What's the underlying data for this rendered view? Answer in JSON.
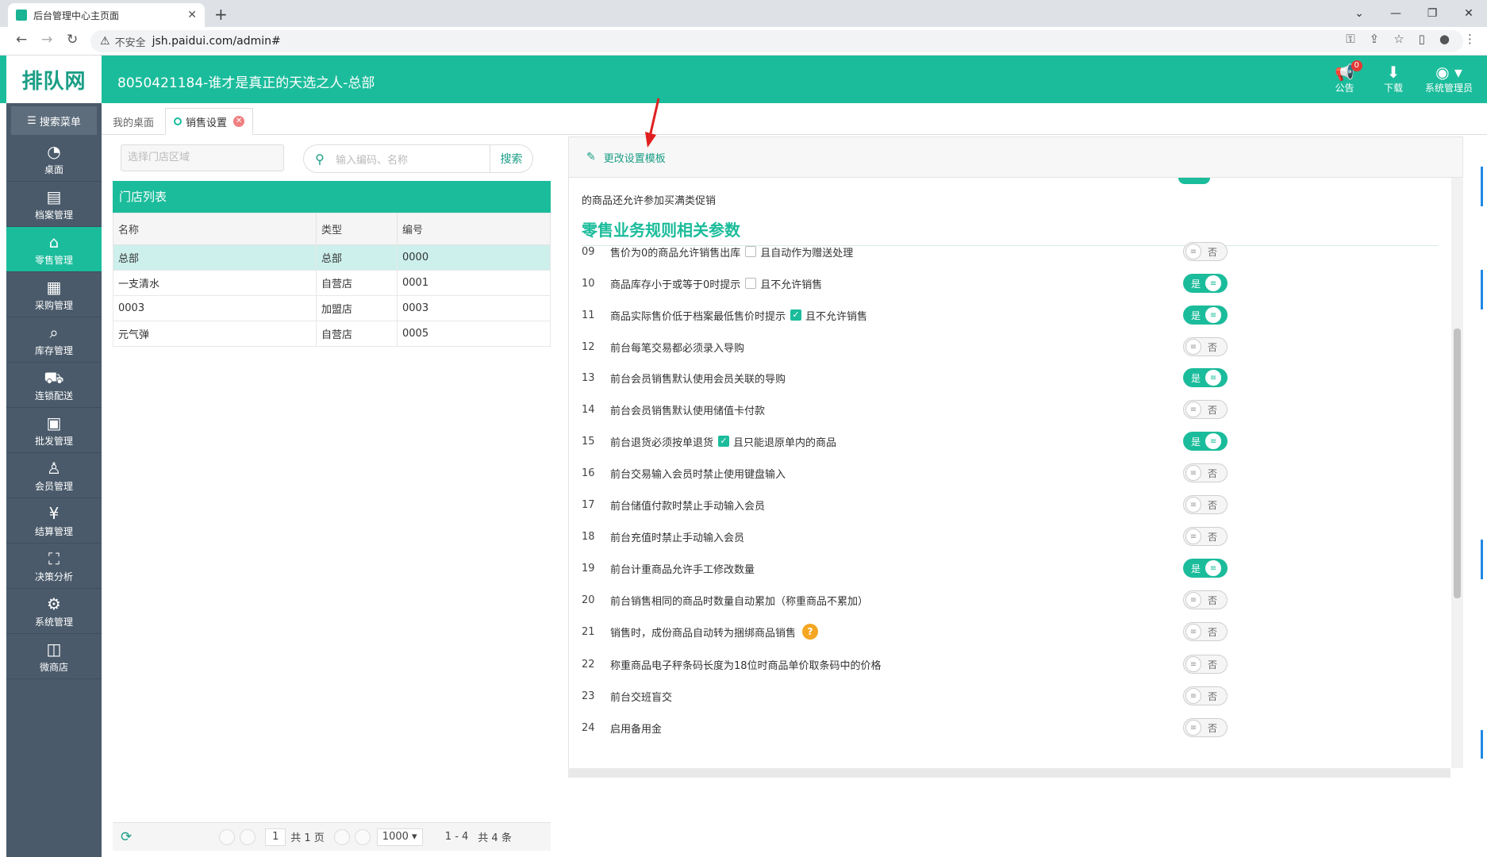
{
  "browser": {
    "tab_title": "后台管理中心主页面",
    "insecure_label": "不安全",
    "url": "jsh.paidui.com/admin#"
  },
  "header": {
    "logo_text": "排队网",
    "title": "8050421184-谁才是真正的天选之人-总部",
    "notice_label": "公告",
    "notice_badge": "0",
    "download_label": "下载",
    "user_label": "系统管理员"
  },
  "sidebar": {
    "search_label": "搜索菜单",
    "items": [
      {
        "label": "桌面",
        "icon": "dashboard-icon"
      },
      {
        "label": "档案管理",
        "icon": "archive-icon"
      },
      {
        "label": "零售管理",
        "icon": "store-icon"
      },
      {
        "label": "采购管理",
        "icon": "purchase-icon"
      },
      {
        "label": "库存管理",
        "icon": "inventory-icon"
      },
      {
        "label": "连锁配送",
        "icon": "delivery-icon"
      },
      {
        "label": "批发管理",
        "icon": "wholesale-icon"
      },
      {
        "label": "会员管理",
        "icon": "member-icon"
      },
      {
        "label": "结算管理",
        "icon": "settlement-icon"
      },
      {
        "label": "决策分析",
        "icon": "analysis-icon"
      },
      {
        "label": "系统管理",
        "icon": "gear-icon"
      },
      {
        "label": "微商店",
        "icon": "shop-bag-icon"
      }
    ],
    "active_index": 2
  },
  "page_tabs": {
    "home": "我的桌面",
    "current": "销售设置"
  },
  "left": {
    "region_placeholder": "选择门店区域",
    "search_placeholder": "输入编码、名称",
    "search_button": "搜索",
    "store_list_title": "门店列表",
    "columns": [
      "名称",
      "类型",
      "编号"
    ],
    "rows": [
      [
        "总部",
        "总部",
        "0000"
      ],
      [
        "一支清水",
        "自营店",
        "0001"
      ],
      [
        "0003",
        "加盟店",
        "0003"
      ],
      [
        "元气弹",
        "自营店",
        "0005"
      ]
    ],
    "pager": {
      "page": "1",
      "total_pages": "共 1 页",
      "page_size": "1000",
      "range": "1 - 4",
      "total": "共 4 条"
    }
  },
  "right": {
    "toolbar_label": "更改设置模板",
    "prev_line": "的商品还允许参加买满类促销",
    "section_title": "零售业务规则相关参数",
    "toggle_on": "是",
    "toggle_off": "否",
    "settings": [
      {
        "no": "09",
        "text": "售价为0的商品允许销售出库",
        "chk": false,
        "chk_text": "且自动作为赠送处理",
        "on": false
      },
      {
        "no": "10",
        "text": "商品库存小于或等于0时提示",
        "chk": false,
        "chk_text": "且不允许销售",
        "on": true
      },
      {
        "no": "11",
        "text": "商品实际售价低于档案最低售价时提示",
        "chk": true,
        "chk_text": "且不允许销售",
        "on": true
      },
      {
        "no": "12",
        "text": "前台每笔交易都必须录入导购",
        "on": false
      },
      {
        "no": "13",
        "text": "前台会员销售默认使用会员关联的导购",
        "on": true
      },
      {
        "no": "14",
        "text": "前台会员销售默认使用储值卡付款",
        "on": false
      },
      {
        "no": "15",
        "text": "前台退货必须按单退货",
        "chk": true,
        "chk_text": "且只能退原单内的商品",
        "on": true
      },
      {
        "no": "16",
        "text": "前台交易输入会员时禁止使用键盘输入",
        "on": false
      },
      {
        "no": "17",
        "text": "前台储值付款时禁止手动输入会员",
        "on": false
      },
      {
        "no": "18",
        "text": "前台充值时禁止手动输入会员",
        "on": false
      },
      {
        "no": "19",
        "text": "前台计重商品允许手工修改数量",
        "on": true
      },
      {
        "no": "20",
        "text": "前台销售相同的商品时数量自动累加（称重商品不累加）",
        "on": false
      },
      {
        "no": "21",
        "text": "销售时，成份商品自动转为捆绑商品销售",
        "help": "?",
        "on": false
      },
      {
        "no": "22",
        "text": "称重商品电子秤条码长度为18位时商品单价取条码中的价格",
        "on": false
      },
      {
        "no": "23",
        "text": "前台交班盲交",
        "on": false
      },
      {
        "no": "24",
        "text": "启用备用金",
        "on": false
      }
    ]
  },
  "colors": {
    "accent": "#1bbc9b",
    "sidebar": "#4a5a6a",
    "annotation_arrow": "#e02020"
  }
}
